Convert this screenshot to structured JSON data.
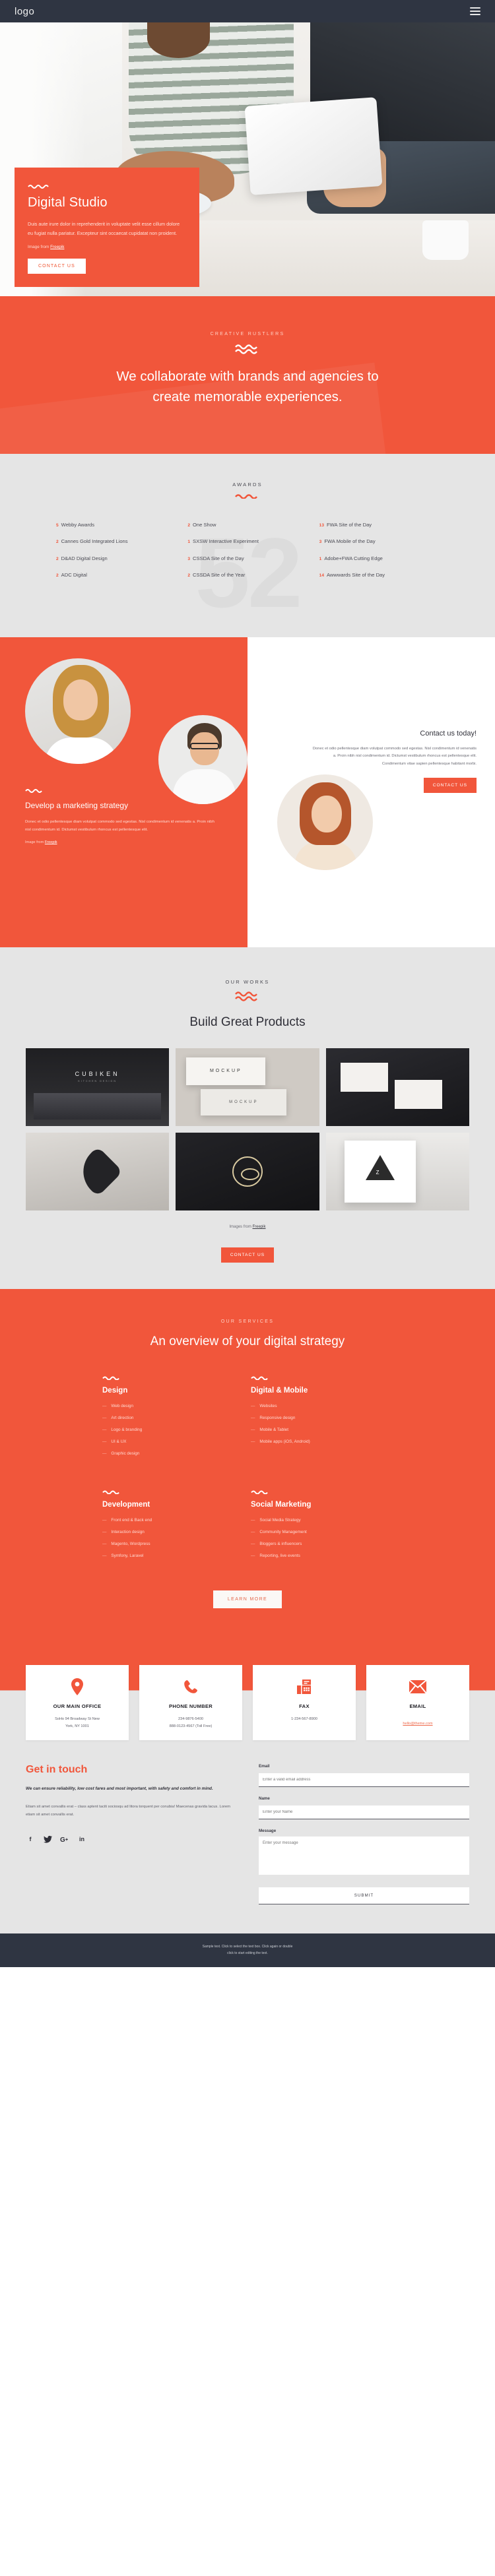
{
  "header": {
    "logo": "logo",
    "menu_icon": "hamburger-icon"
  },
  "hero": {
    "title": "Digital Studio",
    "paragraph": "Duis aute irure dolor in reprehenderit in voluptate velit esse cillum dolore eu fugiat nulla pariatur. Excepteur sint occaecat cupidatat non proident.",
    "credit_prefix": "Image from ",
    "credit_link": "Freepik",
    "button": "CONTACT US"
  },
  "collab": {
    "eyebrow": "CREATIVE RUSTLERS",
    "heading": "We collaborate with brands and agencies to create memorable experiences."
  },
  "awards": {
    "eyebrow": "AWARDS",
    "big_number": "52",
    "items": [
      {
        "count": "5",
        "label": "Webby Awards"
      },
      {
        "count": "2",
        "label": "Cannes Gold Integrated Lions"
      },
      {
        "count": "2",
        "label": "D&AD Digital Design"
      },
      {
        "count": "2",
        "label": "ADC Digital"
      },
      {
        "count": "2",
        "label": "One Show"
      },
      {
        "count": "1",
        "label": "SXSW Interactive Experiment"
      },
      {
        "count": "3",
        "label": "CSSDA Site of the Day"
      },
      {
        "count": "2",
        "label": "CSSDA Site of the Year"
      },
      {
        "count": "13",
        "label": "FWA Site of the Day"
      },
      {
        "count": "3",
        "label": "FWA Mobile of the Day"
      },
      {
        "count": "1",
        "label": "Adobe+FWA Cutting Edge"
      },
      {
        "count": "14",
        "label": "Awwwards Site of the Day"
      }
    ]
  },
  "team": {
    "strategy_title": "Develop a marketing strategy",
    "strategy_paragraph": "Donec et odio pellentesque diam volutpat commodo sed egestas. Nisl condimentum id venenatis a. Proin nibh nisl condimentum id. Dictumst vestibulum rhoncus est pellentesque elit.",
    "strategy_credit_prefix": "Image from ",
    "strategy_credit_link": "Freepik",
    "contact_title": "Contact us today!",
    "contact_paragraph": "Donec et odio pellentesque diam volutpat commodo sed egestas. Nisl condimentum id venenatis a. Proin nibh nisl condimentum id. Dictumst vestibulum rhoncus est pellentesque elit. Condimentum vitae sapien pellentesque habitant morbi.",
    "contact_button": "CONTACT US"
  },
  "works": {
    "eyebrow": "OUR WORKS",
    "heading": "Build Great Products",
    "tiles": [
      {
        "caption": "CUBIKEN",
        "sub": "KITCHEN DESIGN"
      },
      {
        "caption": "MOCKUP",
        "sub": "MOCKUP"
      },
      {
        "caption": "",
        "sub": ""
      },
      {
        "caption": "",
        "sub": ""
      },
      {
        "caption": "",
        "sub": ""
      },
      {
        "caption": "Z",
        "sub": ""
      }
    ],
    "credit_prefix": "Images from ",
    "credit_link": "Freepik",
    "button": "CONTACT US"
  },
  "services": {
    "eyebrow": "OUR SERVICES",
    "heading": "An overview of your digital strategy",
    "groups": [
      {
        "title": "Design",
        "items": [
          "Web design",
          "Art direction",
          "Logo & branding",
          "UI & UX",
          "Graphic design"
        ]
      },
      {
        "title": "Digital & Mobile",
        "items": [
          "Websites",
          "Responsive design",
          "Mobile & Tablet",
          "Mobile apps (iOS, Android)"
        ]
      },
      {
        "title": "Development",
        "items": [
          "Front end & Back end",
          "Interaction design",
          "Magento, Wordpress",
          "Symfony, Laravel"
        ]
      },
      {
        "title": "Social Marketing",
        "items": [
          "Social Media Strategy",
          "Community Management",
          "Bloggers & influencers",
          "Reporting, live events"
        ]
      }
    ],
    "button": "LEARN MORE"
  },
  "contact_cards": [
    {
      "icon": "map-pin-icon",
      "title": "OUR MAIN OFFICE",
      "lines": [
        "SoHo 94 Broadway St New",
        "York, NY 1001"
      ],
      "link": ""
    },
    {
      "icon": "phone-icon",
      "title": "PHONE NUMBER",
      "lines": [
        "234-9876-5400",
        "888-0123-4567 (Toll Free)"
      ],
      "link": ""
    },
    {
      "icon": "fax-icon",
      "title": "FAX",
      "lines": [
        "1-234-567-8900"
      ],
      "link": ""
    },
    {
      "icon": "envelope-icon",
      "title": "EMAIL",
      "lines": [],
      "link": "hello@theme.com"
    }
  ],
  "touch": {
    "heading": "Get in touch",
    "lead": "We can ensure reliability, low cost fares and most important, with safety and comfort in mind.",
    "body": "Etiam sit amet convallis erat – class aptent taciti sociosqu ad litora torquent per conubia! Maecenas gravida lacus. Lorem etiam sit amet convallis erat.",
    "socials": [
      "facebook-icon",
      "twitter-icon",
      "google-plus-icon",
      "linkedin-icon"
    ],
    "form": {
      "email_label": "Email",
      "email_placeholder": "Enter a valid email address",
      "name_label": "Name",
      "name_placeholder": "Enter your Name",
      "message_label": "Message",
      "message_placeholder": "Enter your message",
      "submit": "SUBMIT"
    }
  },
  "footer": {
    "line1": "Sample text. Click to select the text box. Click again or double",
    "line2": "click to start editing the text."
  },
  "colors": {
    "accent": "#f1563b",
    "dark": "#2f3542",
    "light_gray": "#e5e5e5"
  }
}
